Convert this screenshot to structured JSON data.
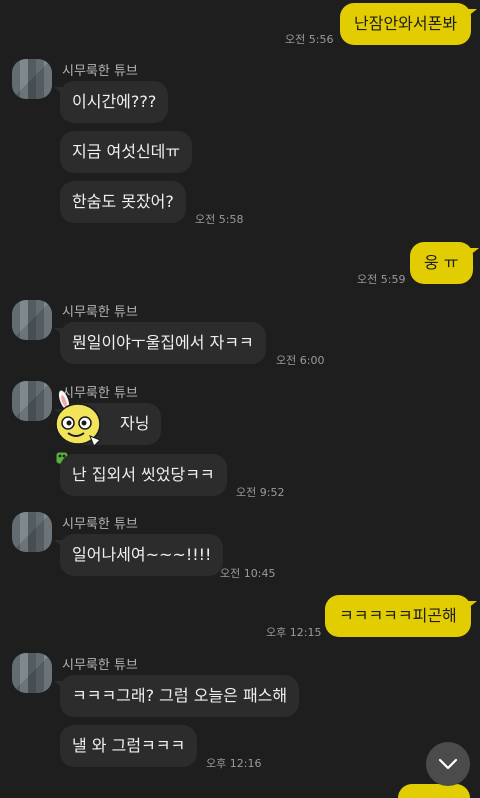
{
  "sender_name": "시무룩한 튜브",
  "messages": {
    "m1": {
      "text": "난잠안와서폰봐",
      "time": "오전 5:56"
    },
    "m2": {
      "text": "이시간에???"
    },
    "m3": {
      "text": "지금 여섯신데ㅠ"
    },
    "m4": {
      "text": "한숨도 못잤어?",
      "time": "오전 5:58"
    },
    "m5": {
      "text": "웅 ㅠ",
      "time": "오전 5:59"
    },
    "m6": {
      "text": "뭔일이야ㅜ울집에서 자ㅋㅋ",
      "time": "오전 6:00"
    },
    "m7": {
      "text": "자닝"
    },
    "m8": {
      "text": "난 집외서 씻었당ㅋㅋ",
      "time": "오전 9:52"
    },
    "m9": {
      "text": "일어나세여~~~!!!!",
      "time": "오전 10:45"
    },
    "m10": {
      "text": "ㅋㅋㅋㅋㅋ피곤해",
      "time": "오후 12:15"
    },
    "m11": {
      "text": "ㅋㅋㅋ그래? 그럼 오늘은 패스해"
    },
    "m12": {
      "text": "낼 와 그럼ㅋㅋㅋ",
      "time": "오후 12:16"
    }
  },
  "icons": {
    "scroll_down": "chevron-down-icon"
  },
  "colors": {
    "background": "#1e1e1e",
    "my_bubble": "#e2cd02",
    "their_bubble": "#2c2c2c"
  }
}
